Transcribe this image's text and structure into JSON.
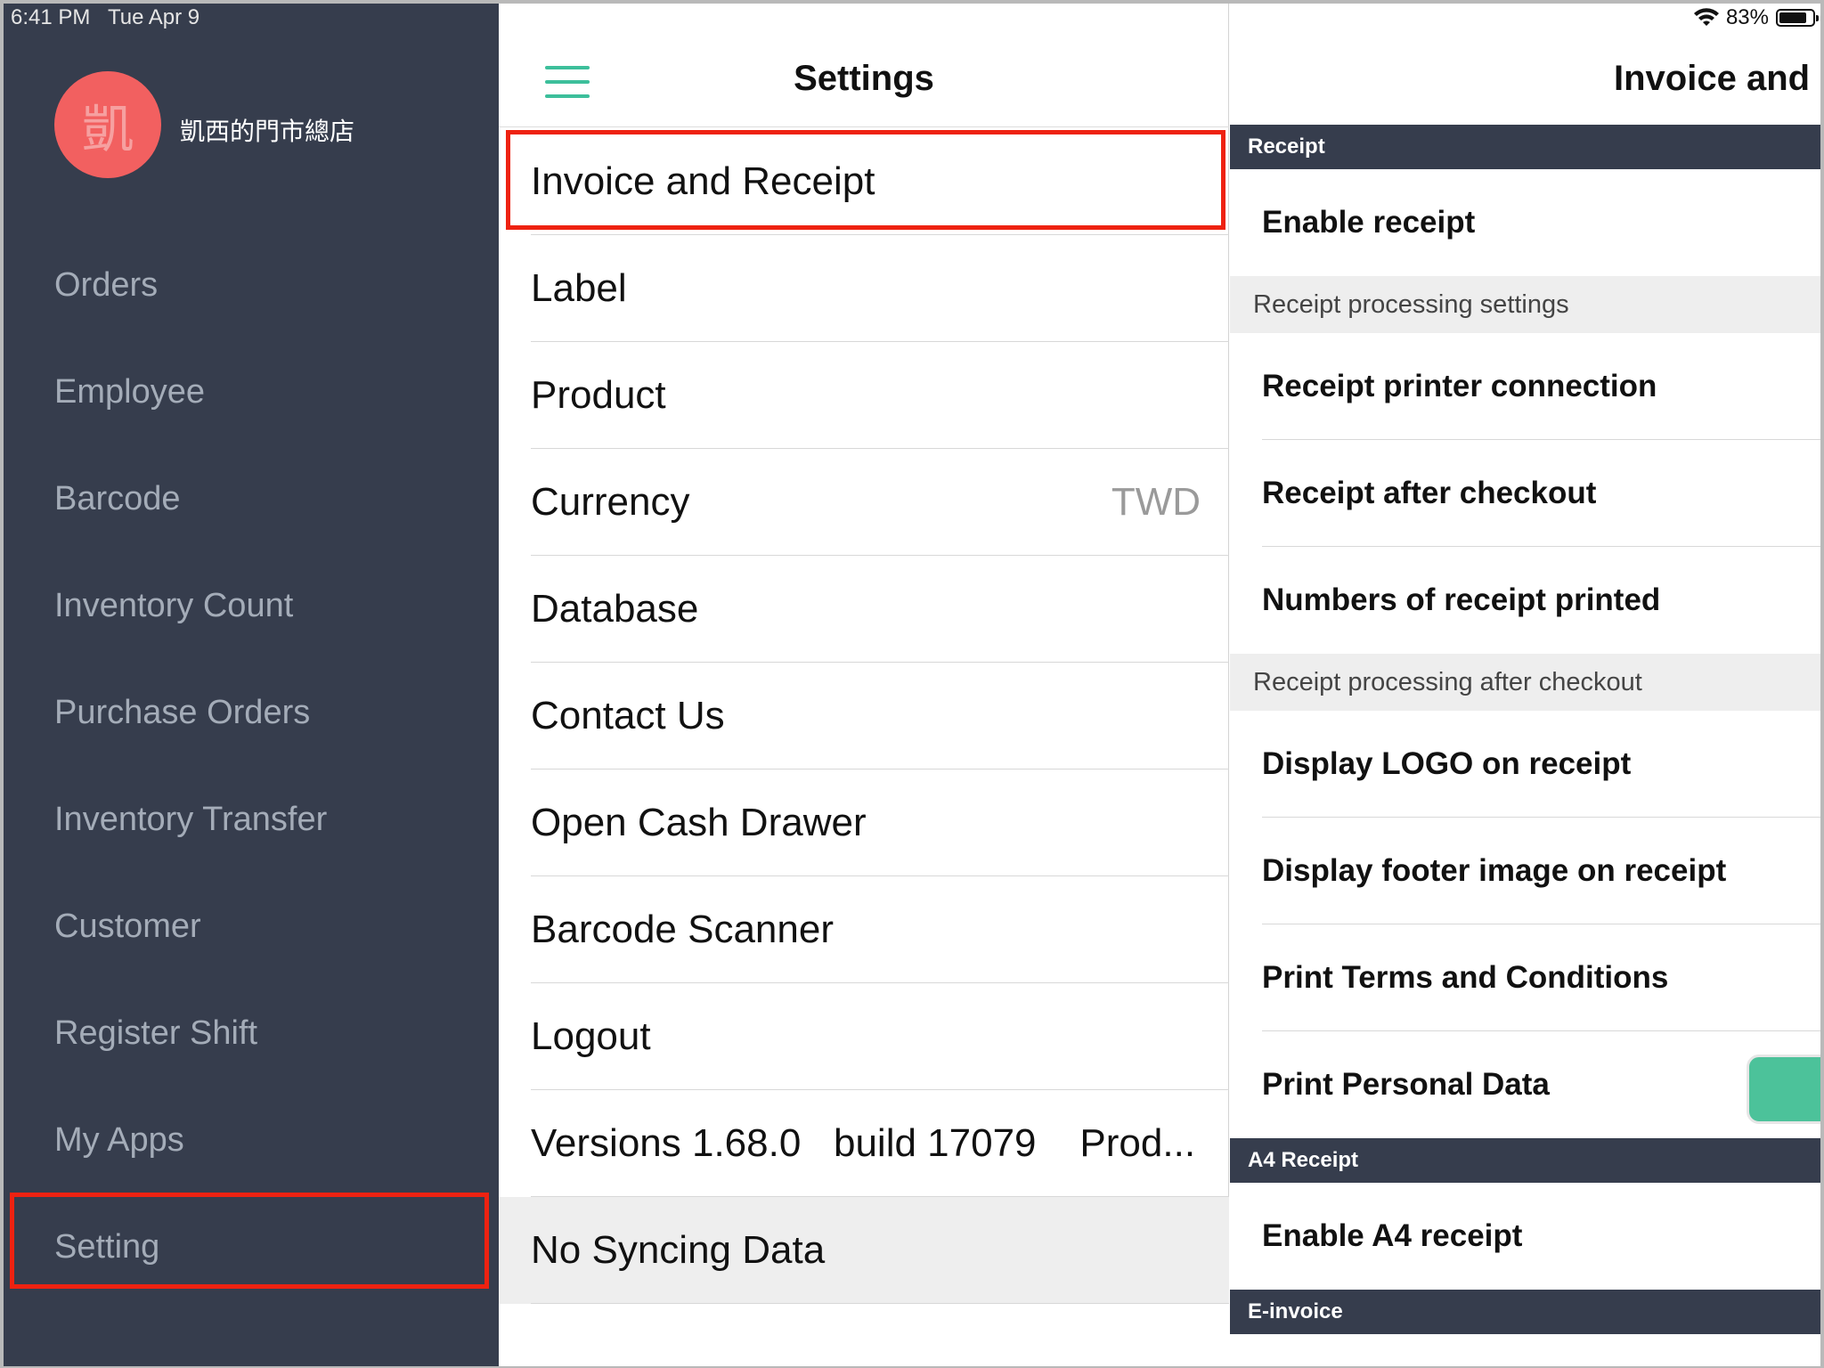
{
  "status_bar": {
    "time": "6:41 PM",
    "date": "Tue Apr 9",
    "battery": "83%",
    "battery_level": 0.83
  },
  "sidebar": {
    "avatar_initial": "凱",
    "store_name": "凱西的門市總店",
    "items": [
      {
        "label": "Orders"
      },
      {
        "label": "Employee"
      },
      {
        "label": "Barcode"
      },
      {
        "label": "Inventory Count"
      },
      {
        "label": "Purchase Orders"
      },
      {
        "label": "Inventory Transfer"
      },
      {
        "label": "Customer"
      },
      {
        "label": "Register Shift"
      },
      {
        "label": "My Apps"
      },
      {
        "label": "Setting"
      }
    ],
    "selected": "Setting"
  },
  "settings": {
    "title": "Settings",
    "items": [
      {
        "label": "Invoice and Receipt"
      },
      {
        "label": "Label"
      },
      {
        "label": "Product"
      },
      {
        "label": "Currency",
        "value": "TWD"
      },
      {
        "label": "Database"
      },
      {
        "label": "Contact Us"
      },
      {
        "label": "Open Cash Drawer"
      },
      {
        "label": "Barcode Scanner"
      },
      {
        "label": "Logout"
      }
    ],
    "versions": "Versions 1.68.0   build 17079    Prod...",
    "sync_status": "No Syncing Data",
    "selected": "Invoice and Receipt"
  },
  "detail": {
    "title": "Invoice and R",
    "sections": {
      "receipt": "Receipt",
      "processing": "Receipt processing settings",
      "after_checkout": "Receipt processing after checkout",
      "a4": "A4 Receipt",
      "einvoice": "E-invoice"
    },
    "rows": {
      "enable_receipt": "Enable receipt",
      "printer_connection": "Receipt printer connection",
      "after_checkout": "Receipt after checkout",
      "numbers_printed": "Numbers of receipt printed",
      "display_logo": "Display LOGO on receipt",
      "display_footer": "Display footer image on receipt",
      "print_terms": "Print Terms and Conditions",
      "print_personal": "Print Personal Data",
      "enable_a4": "Enable A4 receipt"
    },
    "toggle_color": "#4cc29a"
  }
}
